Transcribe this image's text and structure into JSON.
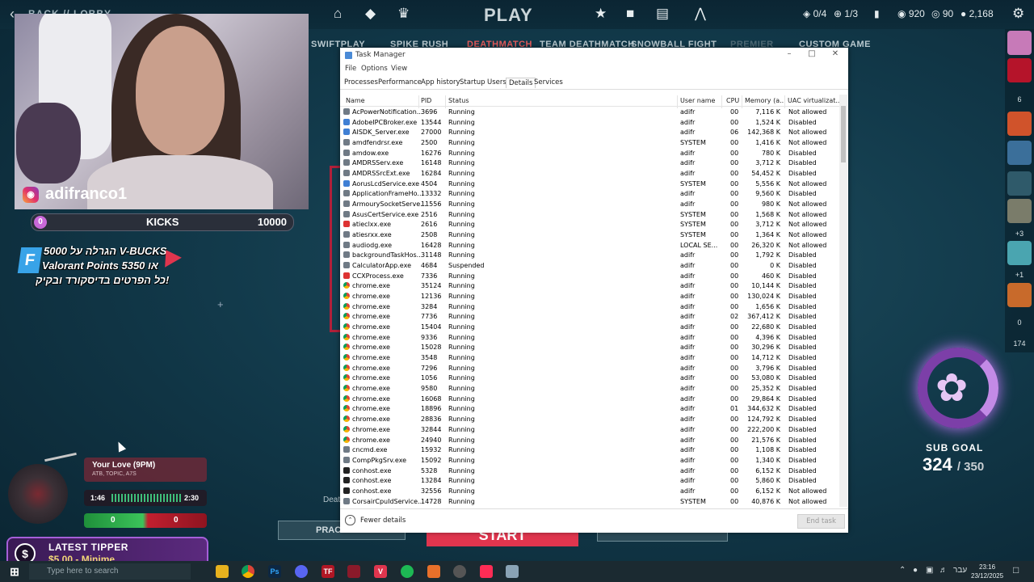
{
  "game": {
    "back_label": "BACK // LOBBY",
    "title": "PLAY",
    "currency": {
      "slots": "0/4",
      "points": "1/3",
      "vp": "920",
      "rp": "90",
      "kp": "2,168"
    },
    "modes": [
      {
        "label": "SWIFTPLAY",
        "state": "normal"
      },
      {
        "label": "SPIKE RUSH",
        "state": "normal"
      },
      {
        "label": "DEATHMATCH",
        "state": "active"
      },
      {
        "label": "TEAM DEATHMATCH",
        "state": "normal"
      },
      {
        "label": "SNOWBALL FIGHT",
        "state": "normal"
      },
      {
        "label": "PREMIER",
        "state": "dim"
      },
      {
        "label": "CUSTOM GAME",
        "state": "normal"
      }
    ],
    "practice_label": "PRACTICE",
    "start_label": "START",
    "death_label": "Death"
  },
  "stream": {
    "ig_handle": "adifranco1",
    "kicks": {
      "current": "0",
      "label": "KICKS",
      "goal": "10000"
    },
    "promo": {
      "line1": "הגרלה על 5000 V-BUCKS",
      "line2": "Valorant Points 5350 או",
      "line3": "כל הפרטים בדיסקורד ובקיק!"
    },
    "music": {
      "title": "Your Love (9PM)",
      "artist": "ATB, TOPIC, A7S",
      "elapsed": "1:46",
      "duration": "2:30",
      "score_left": "0",
      "score_right": "0"
    },
    "tipper": {
      "title": "LATEST TIPPER",
      "value": "$5.00 - Minime"
    },
    "sub_goal": {
      "label": "SUB GOAL",
      "current": "324",
      "total": "/ 350",
      "progress": 0.926
    },
    "rail_numbers": [
      "6",
      "+3",
      "+1",
      "0",
      "174"
    ]
  },
  "task_manager": {
    "title": "Task Manager",
    "menu": [
      "File",
      "Options",
      "View"
    ],
    "tabs": [
      "Processes",
      "Performance",
      "App history",
      "Startup",
      "Users",
      "Details",
      "Services"
    ],
    "selected_tab": "Details",
    "columns": [
      "Name",
      "PID",
      "Status",
      "User name",
      "CPU",
      "Memory (a...",
      "UAC virtualizat..."
    ],
    "rows": [
      [
        "AcPowerNotification...",
        "3696",
        "Running",
        "adifr",
        "00",
        "7,116 K",
        "Not allowed",
        "gen"
      ],
      [
        "AdobeIPCBroker.exe",
        "13544",
        "Running",
        "adifr",
        "00",
        "1,524 K",
        "Disabled",
        "blue"
      ],
      [
        "AISDK_Server.exe",
        "27000",
        "Running",
        "adifr",
        "06",
        "142,368 K",
        "Not allowed",
        "blue"
      ],
      [
        "amdfendrsr.exe",
        "2500",
        "Running",
        "SYSTEM",
        "00",
        "1,416 K",
        "Not allowed",
        "gen"
      ],
      [
        "amdow.exe",
        "16276",
        "Running",
        "adifr",
        "00",
        "780 K",
        "Disabled",
        "gen"
      ],
      [
        "AMDRSServ.exe",
        "16148",
        "Running",
        "adifr",
        "00",
        "3,712 K",
        "Disabled",
        "gen"
      ],
      [
        "AMDRSSrcExt.exe",
        "16284",
        "Running",
        "adifr",
        "00",
        "54,452 K",
        "Disabled",
        "gen"
      ],
      [
        "AorusLcdService.exe",
        "4504",
        "Running",
        "SYSTEM",
        "00",
        "5,556 K",
        "Not allowed",
        "blue"
      ],
      [
        "ApplicationFrameHo...",
        "13332",
        "Running",
        "adifr",
        "00",
        "9,560 K",
        "Disabled",
        "gen"
      ],
      [
        "ArmourySocketServe...",
        "11556",
        "Running",
        "adifr",
        "00",
        "980 K",
        "Not allowed",
        "gen"
      ],
      [
        "AsusCertService.exe",
        "2516",
        "Running",
        "SYSTEM",
        "00",
        "1,568 K",
        "Not allowed",
        "gen"
      ],
      [
        "atieclxx.exe",
        "2616",
        "Running",
        "SYSTEM",
        "00",
        "3,712 K",
        "Not allowed",
        "red"
      ],
      [
        "atiesrxx.exe",
        "2508",
        "Running",
        "SYSTEM",
        "00",
        "1,364 K",
        "Not allowed",
        "gen"
      ],
      [
        "audiodg.exe",
        "16428",
        "Running",
        "LOCAL SE...",
        "00",
        "26,320 K",
        "Not allowed",
        "gen"
      ],
      [
        "backgroundTaskHos...",
        "31148",
        "Running",
        "adifr",
        "00",
        "1,792 K",
        "Disabled",
        "gen"
      ],
      [
        "CalculatorApp.exe",
        "4684",
        "Suspended",
        "adifr",
        "00",
        "0 K",
        "Disabled",
        "gen"
      ],
      [
        "CCXProcess.exe",
        "7336",
        "Running",
        "adifr",
        "00",
        "460 K",
        "Disabled",
        "red"
      ],
      [
        "chrome.exe",
        "35124",
        "Running",
        "adifr",
        "00",
        "10,144 K",
        "Disabled",
        "chrome"
      ],
      [
        "chrome.exe",
        "12136",
        "Running",
        "adifr",
        "00",
        "130,024 K",
        "Disabled",
        "chrome"
      ],
      [
        "chrome.exe",
        "3284",
        "Running",
        "adifr",
        "00",
        "1,656 K",
        "Disabled",
        "chrome"
      ],
      [
        "chrome.exe",
        "7736",
        "Running",
        "adifr",
        "02",
        "367,412 K",
        "Disabled",
        "chrome"
      ],
      [
        "chrome.exe",
        "15404",
        "Running",
        "adifr",
        "00",
        "22,680 K",
        "Disabled",
        "chrome"
      ],
      [
        "chrome.exe",
        "9336",
        "Running",
        "adifr",
        "00",
        "4,396 K",
        "Disabled",
        "chrome"
      ],
      [
        "chrome.exe",
        "15028",
        "Running",
        "adifr",
        "00",
        "30,296 K",
        "Disabled",
        "chrome"
      ],
      [
        "chrome.exe",
        "3548",
        "Running",
        "adifr",
        "00",
        "14,712 K",
        "Disabled",
        "chrome"
      ],
      [
        "chrome.exe",
        "7296",
        "Running",
        "adifr",
        "00",
        "3,796 K",
        "Disabled",
        "chrome"
      ],
      [
        "chrome.exe",
        "1056",
        "Running",
        "adifr",
        "00",
        "53,080 K",
        "Disabled",
        "chrome"
      ],
      [
        "chrome.exe",
        "9580",
        "Running",
        "adifr",
        "00",
        "25,352 K",
        "Disabled",
        "chrome"
      ],
      [
        "chrome.exe",
        "16068",
        "Running",
        "adifr",
        "00",
        "29,864 K",
        "Disabled",
        "chrome"
      ],
      [
        "chrome.exe",
        "18896",
        "Running",
        "adifr",
        "01",
        "344,632 K",
        "Disabled",
        "chrome"
      ],
      [
        "chrome.exe",
        "28836",
        "Running",
        "adifr",
        "00",
        "124,792 K",
        "Disabled",
        "chrome"
      ],
      [
        "chrome.exe",
        "32844",
        "Running",
        "adifr",
        "00",
        "222,200 K",
        "Disabled",
        "chrome"
      ],
      [
        "chrome.exe",
        "24940",
        "Running",
        "adifr",
        "00",
        "21,576 K",
        "Disabled",
        "chrome"
      ],
      [
        "cncmd.exe",
        "15932",
        "Running",
        "adifr",
        "00",
        "1,108 K",
        "Disabled",
        "gen"
      ],
      [
        "CompPkgSrv.exe",
        "15092",
        "Running",
        "adifr",
        "00",
        "1,340 K",
        "Disabled",
        "gen"
      ],
      [
        "conhost.exe",
        "5328",
        "Running",
        "adifr",
        "00",
        "6,152 K",
        "Disabled",
        "term"
      ],
      [
        "conhost.exe",
        "13284",
        "Running",
        "adifr",
        "00",
        "5,860 K",
        "Disabled",
        "term"
      ],
      [
        "conhost.exe",
        "32556",
        "Running",
        "adifr",
        "00",
        "6,152 K",
        "Not allowed",
        "term"
      ],
      [
        "CorsairCpuIdService...",
        "14728",
        "Running",
        "SYSTEM",
        "00",
        "40,876 K",
        "Not allowed",
        "gen"
      ]
    ],
    "fewer_details": "Fewer details",
    "end_task": "End task"
  },
  "taskbar": {
    "search_placeholder": "Type here to search",
    "apps": [
      "file-explorer-icon",
      "chrome-icon",
      "photoshop-icon",
      "discord-icon",
      "tf-icon",
      "game-icon",
      "valorant-icon",
      "spotify-icon",
      "obs-icon",
      "steam-icon",
      "capcut-icon",
      "notepad-icon"
    ],
    "lang": "עבר",
    "time": "23:16",
    "date": "23/12/2025"
  }
}
